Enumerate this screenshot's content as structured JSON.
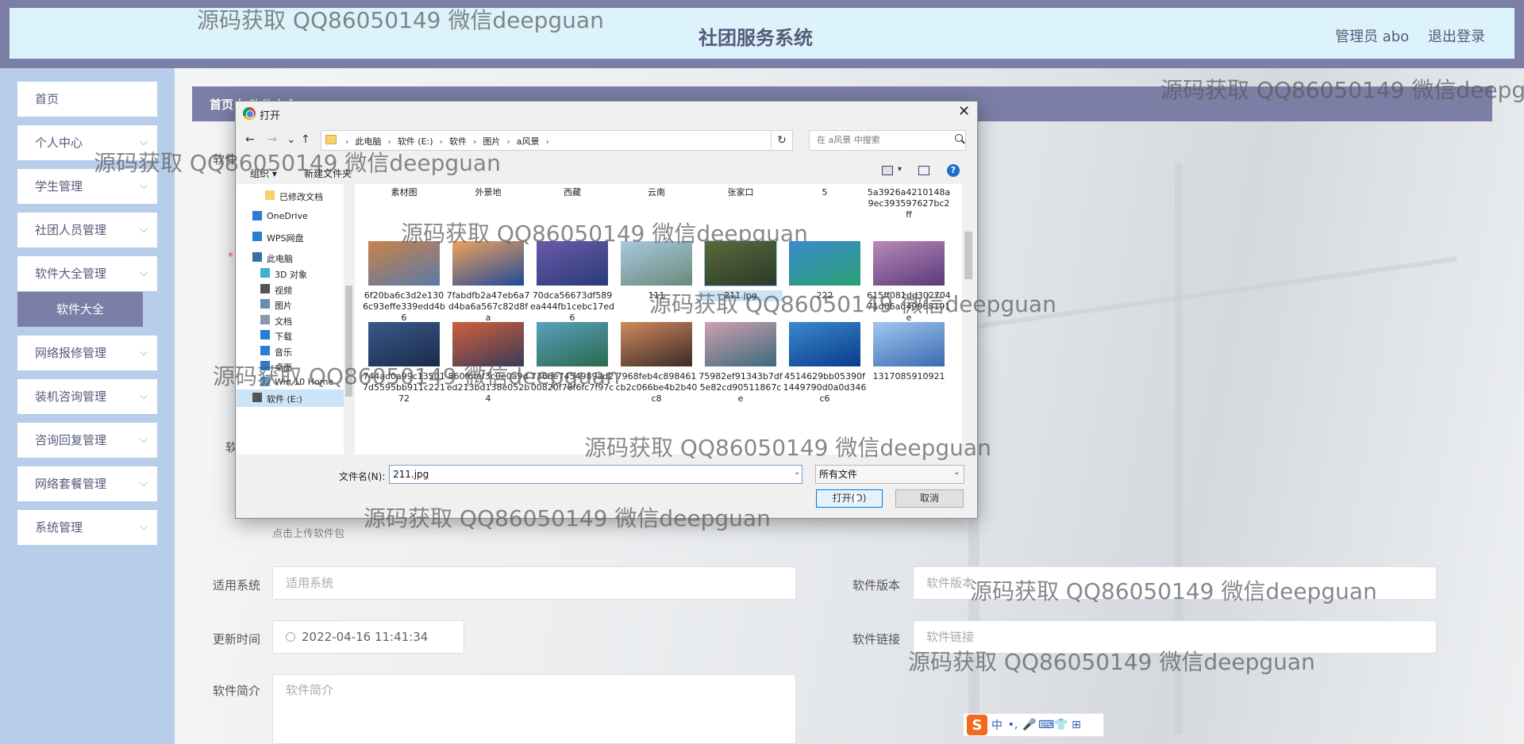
{
  "header": {
    "title": "社团服务系统",
    "user": "管理员 abo",
    "logout": "退出登录"
  },
  "sidebar": {
    "items": [
      {
        "label": "首页",
        "expandable": false
      },
      {
        "label": "个人中心",
        "expandable": true
      },
      {
        "label": "学生管理",
        "expandable": true
      },
      {
        "label": "社团人员管理",
        "expandable": true
      },
      {
        "label": "软件大全管理",
        "expandable": true
      },
      {
        "label": "软件大全",
        "active": true
      },
      {
        "label": "网络报修管理",
        "expandable": true
      },
      {
        "label": "装机咨询管理",
        "expandable": true
      },
      {
        "label": "咨询回复管理",
        "expandable": true
      },
      {
        "label": "网络套餐管理",
        "expandable": true
      },
      {
        "label": "系统管理",
        "expandable": true
      }
    ],
    "chevron": "⌵"
  },
  "breadcrumb": {
    "home": "首页",
    "separator": "/",
    "current": "软件大全"
  },
  "form": {
    "name_label": "软件",
    "file_label": "软",
    "upload_hint": "点击上传软件包",
    "system_label": "适用系统",
    "system_placeholder": "适用系统",
    "version_label": "软件版本",
    "version_placeholder": "软件版本",
    "update_label": "更新时间",
    "update_value": "2022-04-16 11:41:34",
    "link_label": "软件链接",
    "link_placeholder": "软件链接",
    "intro_label": "软件简介",
    "intro_placeholder": "软件简介",
    "required_mark": "*"
  },
  "dialog": {
    "title": "打开",
    "close": "✕",
    "nav": {
      "back": "←",
      "forward": "→",
      "down": "⌄",
      "up": "↑"
    },
    "address": [
      "此电脑",
      "软件 (E:)",
      "软件",
      "图片",
      "a风景"
    ],
    "address_sep": "›",
    "refresh": "↻",
    "search_placeholder": "在 a风景 中搜索",
    "toolbar": {
      "organize": "组织 ▾",
      "new_folder": "新建文件夹",
      "help": "?"
    },
    "tree": [
      {
        "label": "已修改文档",
        "color": "#f5d26b"
      },
      {
        "label": "OneDrive",
        "color": "#2b7cd3"
      },
      {
        "label": "WPS网盘",
        "color": "#2b7cd3"
      },
      {
        "label": "此电脑",
        "color": "#3a6ea5"
      },
      {
        "label": "3D 对象",
        "color": "#40b0d0"
      },
      {
        "label": "视频",
        "color": "#555"
      },
      {
        "label": "图片",
        "color": "#6a8cb0"
      },
      {
        "label": "文档",
        "color": "#8899aa"
      },
      {
        "label": "下载",
        "color": "#2b7cd3"
      },
      {
        "label": "音乐",
        "color": "#2b7cd3"
      },
      {
        "label": "桌面",
        "color": "#2b7cd3"
      },
      {
        "label": "Win 10 Home",
        "color": "#6699cc"
      },
      {
        "label": "软件 (E:)",
        "color": "#555"
      }
    ],
    "files": [
      {
        "name": "素材图",
        "c1": "#e8d9b0",
        "c2": "#c9b487"
      },
      {
        "name": "外景地",
        "c1": "#e4d4a8",
        "c2": "#bca47a"
      },
      {
        "name": "西藏",
        "c1": "#d8c8a0",
        "c2": "#a89070"
      },
      {
        "name": "云南",
        "c1": "#d8d0b0",
        "c2": "#9ab080"
      },
      {
        "name": "张家口",
        "c1": "#d0c8a0",
        "c2": "#8aa070"
      },
      {
        "name": "5",
        "c1": "#7a9a5a",
        "c2": "#4a6a3a"
      },
      {
        "name": "5a3926a4210148a9ec393597627bc2ff",
        "c1": "#8a4a3a",
        "c2": "#4a2a2a"
      },
      {
        "name": "6f20ba6c3d2e1306c93effe339edd4b6",
        "c1": "#c8824a",
        "c2": "#5a7aa8"
      },
      {
        "name": "7fabdfb2a47eb6a7d4ba6a567c82d8fa",
        "c1": "#f2a25a",
        "c2": "#1e4a9a"
      },
      {
        "name": "70dca56673df589ea444fb1cebc17ed6",
        "c1": "#6a5aa8",
        "c2": "#2a3a7a"
      },
      {
        "name": "111",
        "c1": "#a8c8e0",
        "c2": "#6a8a7a"
      },
      {
        "name": "211.jpg",
        "c1": "#5a6a3a",
        "c2": "#2a3a2a"
      },
      {
        "name": "222",
        "c1": "#3a8ad0",
        "c2": "#2aa070"
      },
      {
        "name": "615ff081dd30270471d06ad49968191e",
        "c1": "#b88ab8",
        "c2": "#5a3a7a"
      },
      {
        "name": "744ad0a99c135017d5595bb911c22172",
        "c1": "#3a5a8a",
        "c2": "#1a2a4a"
      },
      {
        "name": "860f6fef3c0e0a9ded213bd138e052b4",
        "c1": "#d0603a",
        "c2": "#3a3a5a"
      },
      {
        "name": "7368e7454989ad200820f78f6fc7f97c",
        "c1": "#5aa0c0",
        "c2": "#2a6a4a"
      },
      {
        "name": "7968feb4c898461cb2c066be4b2b40c8",
        "c1": "#d08a5a",
        "c2": "#3a2a2a"
      },
      {
        "name": "75982ef91343b7df5e82cd90511867ce",
        "c1": "#d0a0b0",
        "c2": "#3a6a7a"
      },
      {
        "name": "4514629bb05390f1449790d0a0d346c6",
        "c1": "#3a8ad0",
        "c2": "#0a3a8a"
      },
      {
        "name": "1317085910921",
        "c1": "#a0c8f0",
        "c2": "#3a6ab0"
      }
    ],
    "selected_file": "211.jpg",
    "filename_label": "文件名(N):",
    "filename_value": "211.jpg",
    "filetype_value": "所有文件",
    "open_button": "打开(O)",
    "cancel_button": "取消"
  },
  "ime": {
    "logo": "S",
    "items": [
      "中",
      "•,",
      "🎤",
      "⌨",
      "👕",
      "⊞"
    ]
  },
  "watermark": "源码获取 QQ86050149 微信deepguan"
}
